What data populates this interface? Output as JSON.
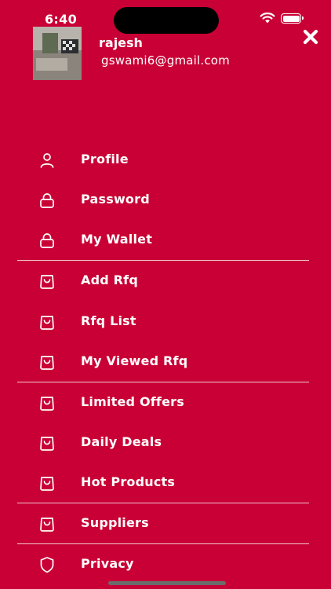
{
  "status": {
    "time": "6:40"
  },
  "user": {
    "name": "rajesh",
    "email": "gswami6@gmail.com"
  },
  "menu": [
    {
      "label": "Profile",
      "icon": "user-icon"
    },
    {
      "label": "Password",
      "icon": "lock-icon"
    },
    {
      "label": "My Wallet",
      "icon": "lock-icon"
    },
    {
      "label": "Add Rfq",
      "icon": "bag-icon"
    },
    {
      "label": "Rfq List",
      "icon": "bag-icon"
    },
    {
      "label": "My Viewed Rfq",
      "icon": "bag-icon"
    },
    {
      "label": "Limited Offers",
      "icon": "bag-icon"
    },
    {
      "label": "Daily Deals",
      "icon": "bag-icon"
    },
    {
      "label": "Hot Products",
      "icon": "bag-icon"
    },
    {
      "label": "Suppliers",
      "icon": "bag-icon"
    },
    {
      "label": "Privacy",
      "icon": "shield-icon"
    }
  ],
  "colors": {
    "background": "#C90035",
    "text": "#FFFFFF",
    "divider": "#F3C7D3"
  }
}
